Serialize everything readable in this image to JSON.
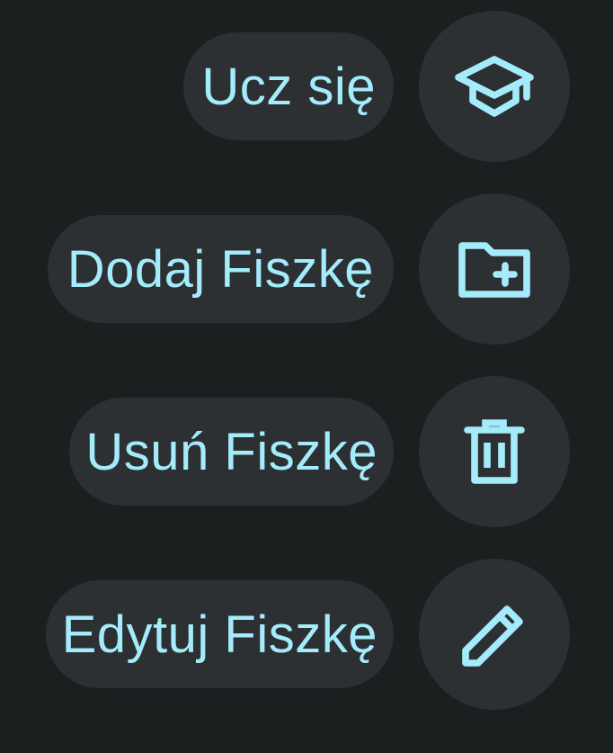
{
  "theme": {
    "background": "#1b1f20",
    "surface": "#2c3032",
    "accent": "#a4ecfb"
  },
  "actions": [
    {
      "label": "Ucz się",
      "icon": "school-icon"
    },
    {
      "label": "Dodaj Fiszkę",
      "icon": "folder-add-icon"
    },
    {
      "label": "Usuń Fiszkę",
      "icon": "trash-icon"
    },
    {
      "label": "Edytuj Fiszkę",
      "icon": "pencil-icon"
    }
  ]
}
